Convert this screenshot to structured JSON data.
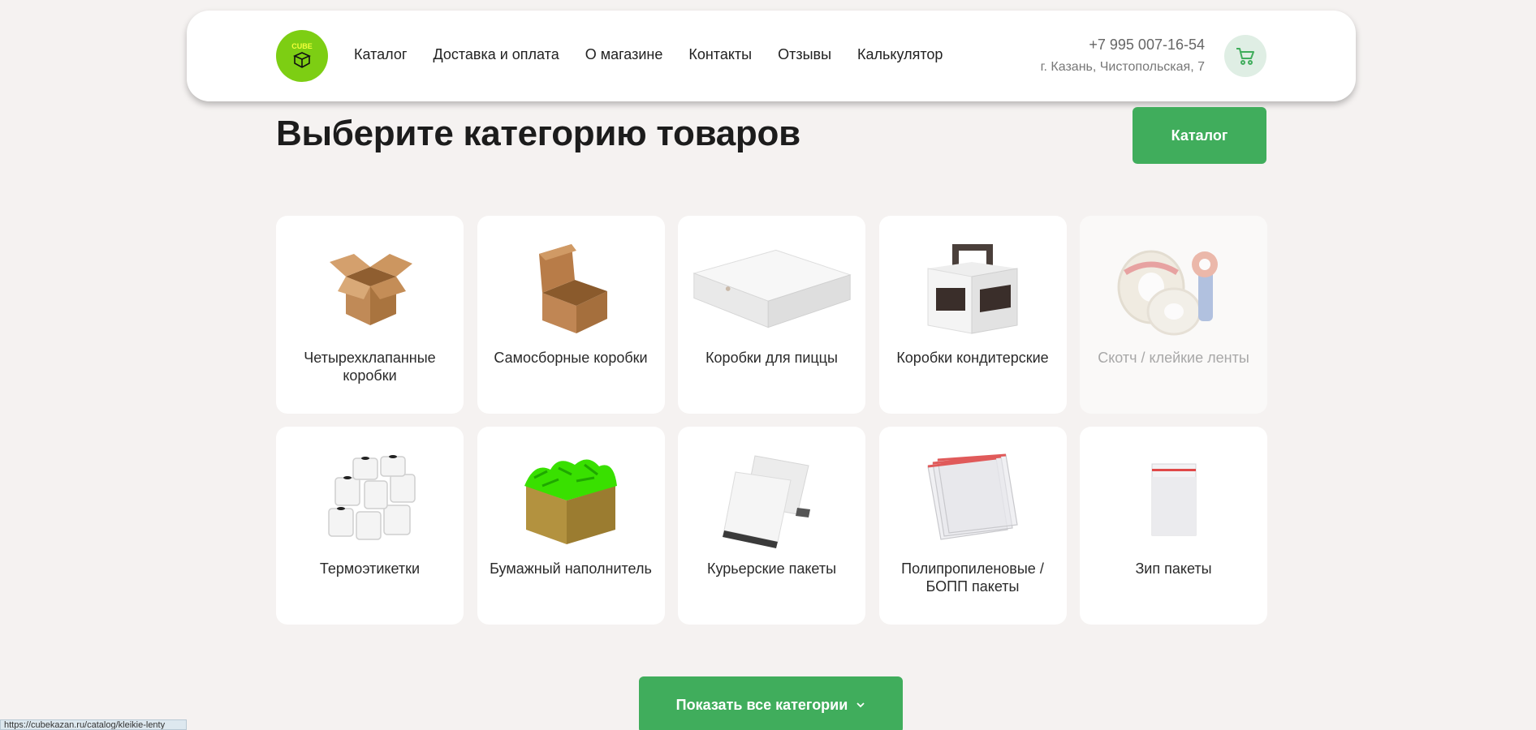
{
  "header": {
    "logo_text": "CUBE",
    "nav": [
      "Каталог",
      "Доставка и оплата",
      "О магазине",
      "Контакты",
      "Отзывы",
      "Калькулятор"
    ],
    "phone": "+7 995 007-16-54",
    "address": "г. Казань, Чистопольская, 7"
  },
  "main": {
    "title": "Выберите категорию товаров",
    "catalog_button": "Каталог",
    "show_all_button": "Показать все категории"
  },
  "categories": [
    {
      "label": "Четырехклапанные коробки",
      "icon": "open-box-icon"
    },
    {
      "label": "Самосборные коробки",
      "icon": "mailer-box-icon"
    },
    {
      "label": "Коробки для пиццы",
      "icon": "pizza-box-icon"
    },
    {
      "label": "Коробки кондитерские",
      "icon": "cake-box-icon"
    },
    {
      "label": "Скотч / клейкие ленты",
      "icon": "tape-icon"
    },
    {
      "label": "Термоэтикетки",
      "icon": "label-rolls-icon"
    },
    {
      "label": "Бумажный наполнитель",
      "icon": "paper-filler-icon"
    },
    {
      "label": "Курьерские пакеты",
      "icon": "courier-bags-icon"
    },
    {
      "label": "Полипропиленовые / БОПП пакеты",
      "icon": "bopp-bags-icon"
    },
    {
      "label": "Зип пакеты",
      "icon": "zip-bag-icon"
    }
  ],
  "status_bar": {
    "url": "https://cubekazan.ru/catalog/kleikie-lenty"
  },
  "colors": {
    "accent": "#40ad5c",
    "logo": "#7dce13",
    "background": "#f5f2f1"
  }
}
